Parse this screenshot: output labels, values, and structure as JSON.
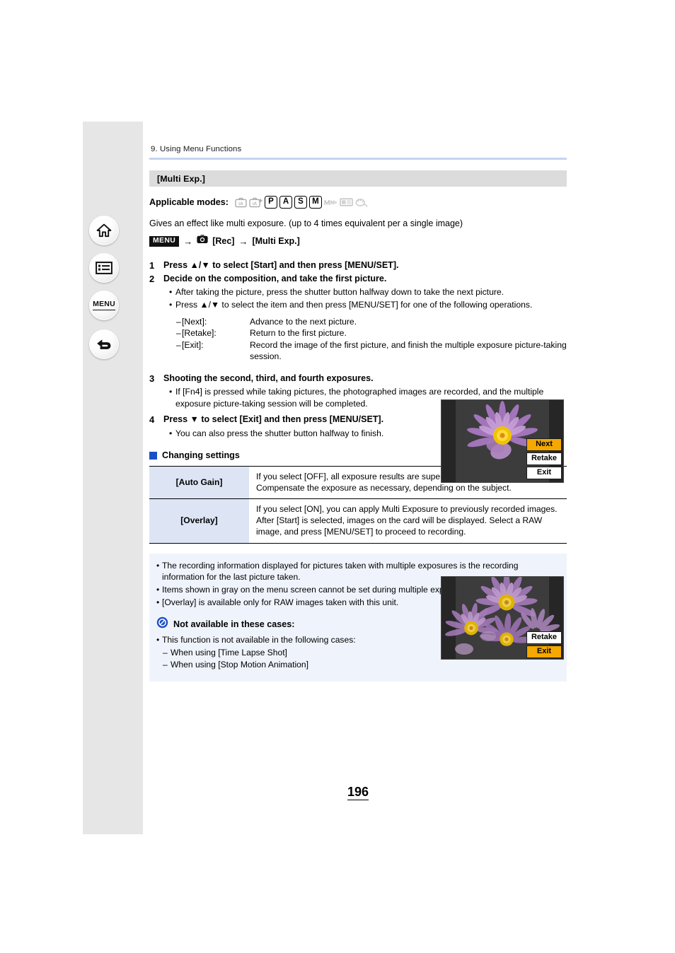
{
  "nav_rail": {
    "buttons": [
      {
        "name": "home",
        "icon": "home-icon"
      },
      {
        "name": "contents",
        "icon": "contents-list-icon"
      },
      {
        "name": "menu",
        "icon": "menu-text-icon",
        "label": "MENU"
      },
      {
        "name": "back",
        "icon": "back-arrow-icon"
      }
    ]
  },
  "header": {
    "breadcrumb": "9. Using Menu Functions",
    "section_title": "[Multi Exp.]"
  },
  "applicable_modes": {
    "label": "Applicable modes:",
    "icons": [
      {
        "name": "ia-mode-icon",
        "glyph": "iA",
        "enabled": false
      },
      {
        "name": "ia-plus-mode-icon",
        "glyph": "iA+",
        "enabled": false
      },
      {
        "name": "p-mode-icon",
        "glyph": "P",
        "enabled": true
      },
      {
        "name": "a-mode-icon",
        "glyph": "A",
        "enabled": true
      },
      {
        "name": "s-mode-icon",
        "glyph": "S",
        "enabled": true
      },
      {
        "name": "m-mode-icon",
        "glyph": "M",
        "enabled": true
      },
      {
        "name": "creative-video-mode-icon",
        "glyph": "M",
        "enabled": false
      },
      {
        "name": "custom-mode-icon",
        "glyph": "C",
        "enabled": false
      },
      {
        "name": "creative-control-mode-icon",
        "glyph": "CC",
        "enabled": false
      }
    ]
  },
  "intro": {
    "description": "Gives an effect like multi exposure. (up to 4 times equivalent per a single image)",
    "menu_badge": "MENU",
    "arrow": "→",
    "rec_label": "[Rec]",
    "target_label": "[Multi Exp.]",
    "camera_icon": "camera-icon"
  },
  "steps": [
    {
      "number": "1",
      "title": "Press ▲/▼ to select [Start] and then press [MENU/SET].",
      "bullets": [],
      "definitions": []
    },
    {
      "number": "2",
      "title": "Decide on the composition, and take the first picture.",
      "bullets": [
        "After taking the picture, press the shutter button halfway down to take the next picture.",
        "Press ▲/▼ to select the item and then press [MENU/SET] for one of the following operations."
      ],
      "definitions": [
        {
          "term": "[Next]:",
          "desc": "Advance to the next picture."
        },
        {
          "term": "[Retake]:",
          "desc": "Return to the first picture."
        },
        {
          "term": "[Exit]:",
          "desc": "Record the image of the first picture, and finish the multiple exposure picture-taking session."
        }
      ]
    },
    {
      "number": "3",
      "title": "Shooting the second, third, and fourth exposures.",
      "bullets": [
        "If [Fn4] is pressed while taking pictures, the photographed images are recorded, and the multiple exposure picture-taking session will be completed."
      ],
      "definitions": []
    },
    {
      "number": "4",
      "title": "Press ▼ to select [Exit] and then press [MENU/SET].",
      "bullets": [
        "You can also press the shutter button halfway to finish."
      ],
      "definitions": []
    }
  ],
  "figures": [
    {
      "name": "camera-screen-first-exposure",
      "subject": "single purple lotus flower on dark background",
      "buttons": [
        {
          "label": "Next",
          "highlighted": true
        },
        {
          "label": "Retake",
          "highlighted": false
        },
        {
          "label": "Exit",
          "highlighted": false
        }
      ]
    },
    {
      "name": "camera-screen-multi-exposure",
      "subject": "multiple overlapping purple lotus flowers on dark background",
      "buttons": [
        {
          "label": "Retake",
          "highlighted": false
        },
        {
          "label": "Exit",
          "highlighted": true
        }
      ]
    }
  ],
  "changing_settings": {
    "heading": "Changing settings",
    "rows": [
      {
        "key": "[Auto Gain]",
        "value": "If you select [OFF], all exposure results are superimposed as they are. Compensate the exposure as necessary, depending on the subject."
      },
      {
        "key": "[Overlay]",
        "value": "If you select [ON], you can apply Multi Exposure to previously recorded images. After [Start] is selected, images on the card will be displayed. Select a RAW image, and press [MENU/SET] to proceed to recording."
      }
    ]
  },
  "notes": {
    "items": [
      "The recording information displayed for pictures taken with multiple exposures is the recording information for the last picture taken.",
      "Items shown in gray on the menu screen cannot be set during multiple exposures.",
      "[Overlay] is available only for RAW images taken with this unit."
    ],
    "not_available": {
      "icon": "prohibited-icon",
      "heading": "Not available in these cases:",
      "lead": "This function is not available in the following cases:",
      "cases": [
        "When using [Time Lapse Shot]",
        "When using [Stop Motion Animation]"
      ]
    }
  },
  "footer": {
    "page_number": "196"
  },
  "colors": {
    "rule": "#c5d3ef",
    "section_band": "#dcdcdc",
    "table_key_bg": "#dde5f5",
    "notes_bg": "#eff4fc",
    "accent_blue": "#1b4fc4",
    "highlight_orange": "#f5a800",
    "rail_bg": "#e6e6e6"
  }
}
